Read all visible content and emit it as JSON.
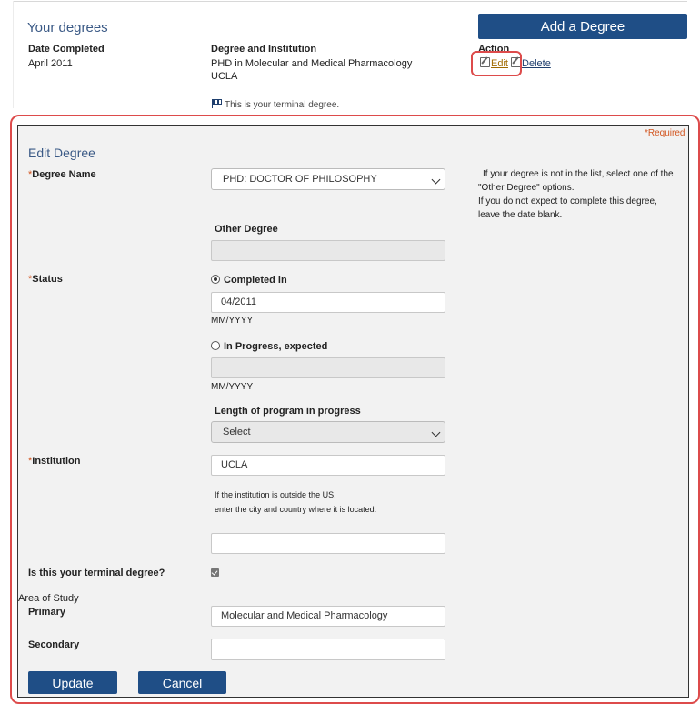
{
  "section": {
    "title": "Your degrees",
    "add_button": "Add a Degree"
  },
  "table": {
    "headers": {
      "date": "Date Completed",
      "degree": "Degree and Institution",
      "action": "Action"
    },
    "row": {
      "date": "April 2011",
      "degree": "PHD in Molecular and Medical Pharmacology",
      "institution": "UCLA",
      "edit": "Edit",
      "delete": "Delete",
      "terminal_note": "This is your terminal degree."
    }
  },
  "form": {
    "required_note": "*Required",
    "title": "Edit Degree",
    "degree_name": {
      "label": "Degree Name",
      "selected": "PHD: DOCTOR OF PHILOSOPHY"
    },
    "help_text": {
      "line1": "If your degree is not in the list, select one of the",
      "line2": "\"Other Degree\" options.",
      "line3": "If you do not expect to complete this degree,",
      "line4": "leave the date blank."
    },
    "other_degree": {
      "label": "Other Degree",
      "value": ""
    },
    "status": {
      "label": "Status",
      "completed_label": "Completed in",
      "completed_value": "04/2011",
      "format1": "MM/YYYY",
      "in_progress_label": "In Progress, expected",
      "in_progress_value": "",
      "format2": "MM/YYYY",
      "length_label": "Length of program in progress",
      "length_selected": "Select"
    },
    "institution": {
      "label": "Institution",
      "value": "UCLA",
      "outside_note1": "If the institution is outside the US,",
      "outside_note2": "enter the city and country where it is located:",
      "location_value": ""
    },
    "terminal": {
      "label": "Is this your terminal degree?",
      "checked": true
    },
    "area_of_study": {
      "label": "Area of Study",
      "primary_label": "Primary",
      "primary_value": "Molecular and Medical Pharmacology",
      "secondary_label": "Secondary",
      "secondary_value": ""
    },
    "buttons": {
      "update": "Update",
      "cancel": "Cancel"
    }
  }
}
